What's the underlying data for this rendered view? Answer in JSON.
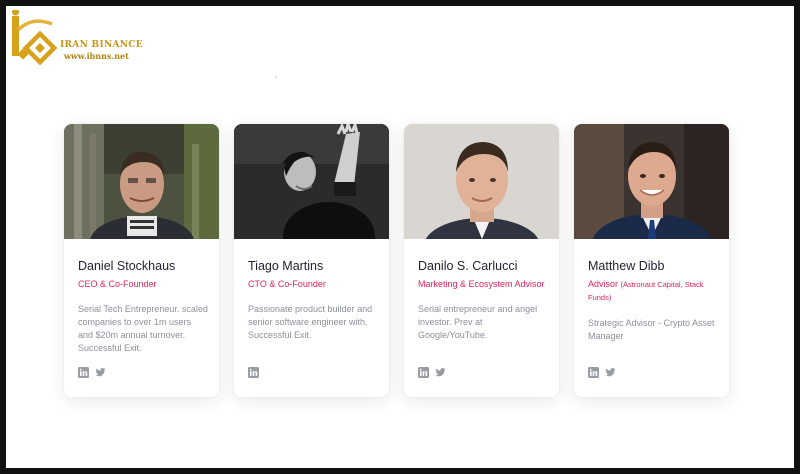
{
  "brand": {
    "name": "IRAN BINANCE",
    "url": "www.ibnns.net",
    "color": "#d4a017"
  },
  "team": [
    {
      "name": "Daniel Stockhaus",
      "role": "CEO & Co-Founder",
      "role_extra": "",
      "bio": "Serial Tech Entrepreneur. scaled companies to over 1m users and $20m annual turnover. Successful Exit.",
      "socials": [
        "linkedin-icon",
        "twitter-icon"
      ]
    },
    {
      "name": "Tiago Martins",
      "role": "CTO & Co-Founder",
      "role_extra": "",
      "bio": "Passionate product builder and senior software engineer with. Successful Exit.",
      "socials": [
        "linkedin-icon"
      ]
    },
    {
      "name": "Danilo S. Carlucci",
      "role": "Marketing & Ecosystem Advisor",
      "role_extra": "",
      "bio": "Serial entrepreneur and angel investor. Prev at Google/YouTube.",
      "socials": [
        "linkedin-icon",
        "twitter-icon"
      ]
    },
    {
      "name": "Matthew Dibb",
      "role": "Advisor",
      "role_extra": "(Astronaut Capital, Stack Funds)",
      "bio": "Strategic Advisor - Crypto Asset Manager",
      "socials": [
        "linkedin-icon",
        "twitter-icon"
      ]
    }
  ],
  "colors": {
    "accent": "#e0245e",
    "bio_text": "#8d909b",
    "name_text": "#1f2030",
    "icon": "#9a9ca3"
  }
}
